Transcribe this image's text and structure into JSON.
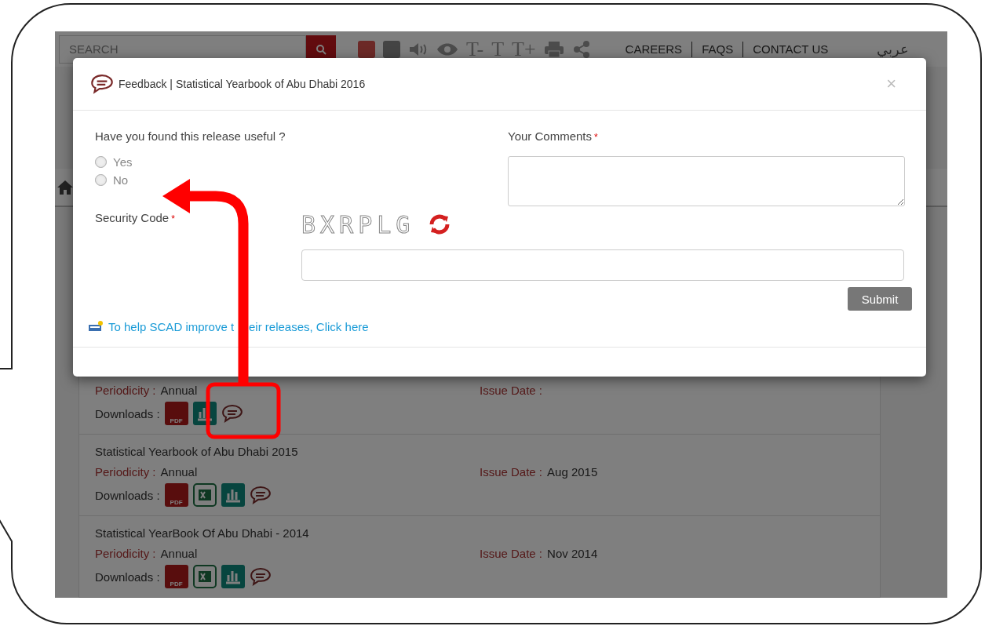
{
  "header": {
    "search": {
      "placeholder": "SEARCH"
    },
    "font_controls": [
      "T-",
      "T",
      "T+"
    ],
    "links": [
      "CAREERS",
      "FAQS",
      "CONTACT US"
    ],
    "language": "عربي"
  },
  "modal": {
    "title": "Feedback | Statistical Yearbook of Abu Dhabi 2016",
    "close": "×",
    "question": "Have you found this release useful ?",
    "options": [
      {
        "label": "Yes",
        "selected": false
      },
      {
        "label": "No",
        "selected": false
      }
    ],
    "comments_label": "Your Comments",
    "comments_required": "*",
    "security_label": "Security Code",
    "security_required": "*",
    "captcha": "BXRPLG",
    "submit": "Submit",
    "help_link": [
      "To help SCAD improve t",
      "eir releases, Click here"
    ]
  },
  "releases": [
    {
      "periodicity_label": "Periodicity :",
      "periodicity": "Annual",
      "issue_label": "Issue Date :",
      "downloads_label": "Downloads :",
      "downloads": [
        {
          "kind": "pdf",
          "label": "PDF"
        },
        {
          "kind": "chart"
        },
        {
          "kind": "feedback"
        }
      ]
    },
    {
      "title": "Statistical Yearbook of Abu Dhabi 2015",
      "periodicity_label": "Periodicity :",
      "periodicity": "Annual",
      "issue_label": "Issue Date :",
      "issue_date": "Aug 2015",
      "downloads_label": "Downloads :",
      "downloads": [
        {
          "kind": "pdf",
          "label": "PDF"
        },
        {
          "kind": "excel"
        },
        {
          "kind": "chart"
        },
        {
          "kind": "feedback"
        }
      ]
    },
    {
      "title": "Statistical YearBook Of Abu Dhabi - 2014",
      "periodicity_label": "Periodicity :",
      "periodicity": "Annual",
      "issue_label": "Issue Date :",
      "issue_date": "Nov 2014",
      "downloads_label": "Downloads :",
      "downloads": [
        {
          "kind": "pdf",
          "label": "PDF"
        },
        {
          "kind": "excel"
        },
        {
          "kind": "chart"
        },
        {
          "kind": "feedback"
        }
      ]
    }
  ]
}
